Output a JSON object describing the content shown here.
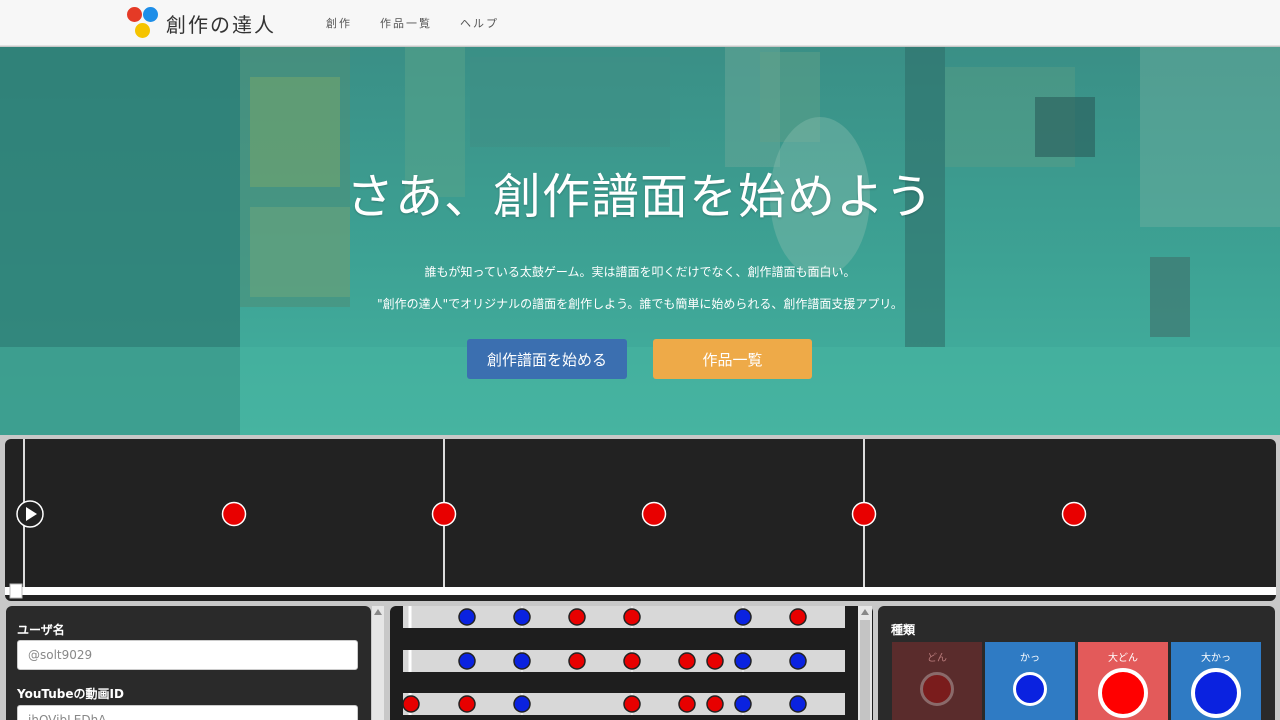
{
  "nav": {
    "brand": "創作の達人",
    "links": [
      "創作",
      "作品一覧",
      "ヘルプ"
    ]
  },
  "hero": {
    "title": "さあ、創作譜面を始めよう",
    "line1": "誰もが知っている太鼓ゲーム。実は譜面を叩くだけでなく、創作譜面も面白い。",
    "line2": "\"創作の達人\"でオリジナルの譜面を創作しよう。誰でも簡単に始められる、創作譜面支援アプリ。",
    "start_button": "創作譜面を始める",
    "list_button": "作品一覧"
  },
  "form": {
    "username_label": "ユーザ名",
    "username_value": "@solt9029",
    "youtube_label": "YouTubeの動画ID",
    "youtube_value": "jhOVibLEDhA"
  },
  "kinds": {
    "title": "種類",
    "items": [
      {
        "label": "どん",
        "bg": "#5a2c2c",
        "fill": "#7a1c1c",
        "ring": "#8a6a6a",
        "size": "small",
        "selected": false
      },
      {
        "label": "かっ",
        "bg": "#2f7bc4",
        "fill": "#0a22e0",
        "ring": "#ffffff",
        "size": "small",
        "selected": true
      },
      {
        "label": "大どん",
        "bg": "#e35a5a",
        "fill": "#ff0000",
        "ring": "#ffffff",
        "size": "large",
        "selected": true
      },
      {
        "label": "大かっ",
        "bg": "#2f7bc4",
        "fill": "#0a22e0",
        "ring": "#ffffff",
        "size": "large",
        "selected": true
      }
    ]
  },
  "colors": {
    "don": "#e80000",
    "ka": "#0a22e0"
  },
  "icons": {
    "play": "play-icon"
  },
  "main_track": {
    "notes": [
      "don",
      "don",
      "don",
      "don",
      "don"
    ]
  },
  "mini_tracks": [
    [
      "ka",
      "ka",
      "don",
      "don",
      "ka",
      "don"
    ],
    [
      "ka",
      "ka",
      "don",
      "don",
      "don",
      "don",
      "ka",
      "ka"
    ],
    [
      "don",
      "don",
      "ka",
      "don",
      "don",
      "don",
      "ka",
      "ka"
    ]
  ]
}
